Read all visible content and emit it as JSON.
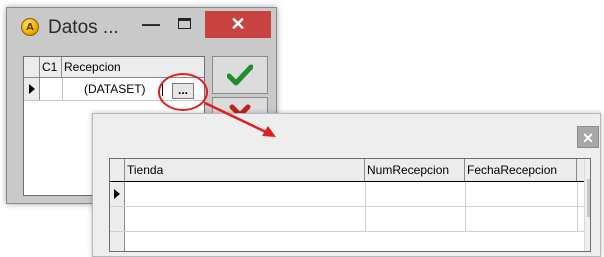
{
  "back_window": {
    "title": "Datos ...",
    "app_icon_letter": "A",
    "minimize_glyph": "—",
    "close_glyph": "✕",
    "grid": {
      "columns": [
        "C1",
        "Recepcion"
      ],
      "row_value": "(DATASET)",
      "ellipsis_label": "..."
    },
    "ok_color": "#1f8f2a",
    "cancel_color": "#c0201d"
  },
  "annotation": {
    "ring_color": "#e02020",
    "arrow_color": "#e02020"
  },
  "front_window": {
    "close_glyph": "✕",
    "grid": {
      "columns": [
        "Tienda",
        "NumRecepcion",
        "FechaRecepcion"
      ]
    },
    "scroll_up_glyph": "▲",
    "scroll_down_glyph": "▼"
  }
}
